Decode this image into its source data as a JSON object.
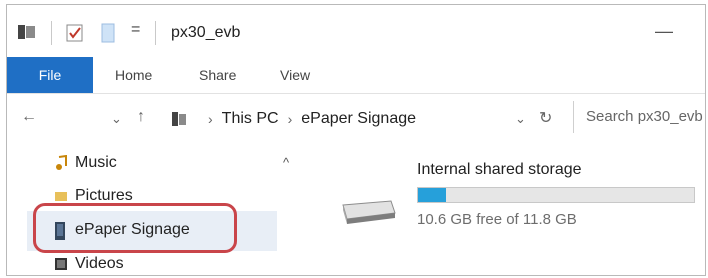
{
  "window": {
    "title": "px30_evb"
  },
  "titlebar": {
    "dropdown_glyph": "=",
    "minimize_glyph": "—"
  },
  "ribbon": {
    "tabs": [
      {
        "label": "File",
        "active": true
      },
      {
        "label": "Home"
      },
      {
        "label": "Share"
      },
      {
        "label": "View"
      }
    ]
  },
  "address": {
    "back_glyph": "←",
    "history_glyph": "⌄",
    "up_glyph": "↑",
    "crumbs": [
      "This PC",
      "ePaper Signage"
    ],
    "dropdown_glyph": "⌄",
    "refresh_glyph": "↻",
    "search_placeholder": "Search px30_evb"
  },
  "sidebar": {
    "collapse_glyph": "^",
    "items": [
      {
        "label": "Music",
        "icon": "music-icon"
      },
      {
        "label": "Pictures",
        "icon": "pictures-icon"
      },
      {
        "label": "ePaper Signage",
        "icon": "device-icon",
        "selected": true
      },
      {
        "label": "Videos",
        "icon": "videos-icon"
      }
    ]
  },
  "content": {
    "storage": {
      "name": "Internal shared storage",
      "free_text": "10.6 GB free of 11.8 GB",
      "used_fraction": 0.102
    }
  },
  "colors": {
    "accent": "#1f6fc5",
    "progress": "#26a0da",
    "highlight_ring": "#c9454a"
  }
}
